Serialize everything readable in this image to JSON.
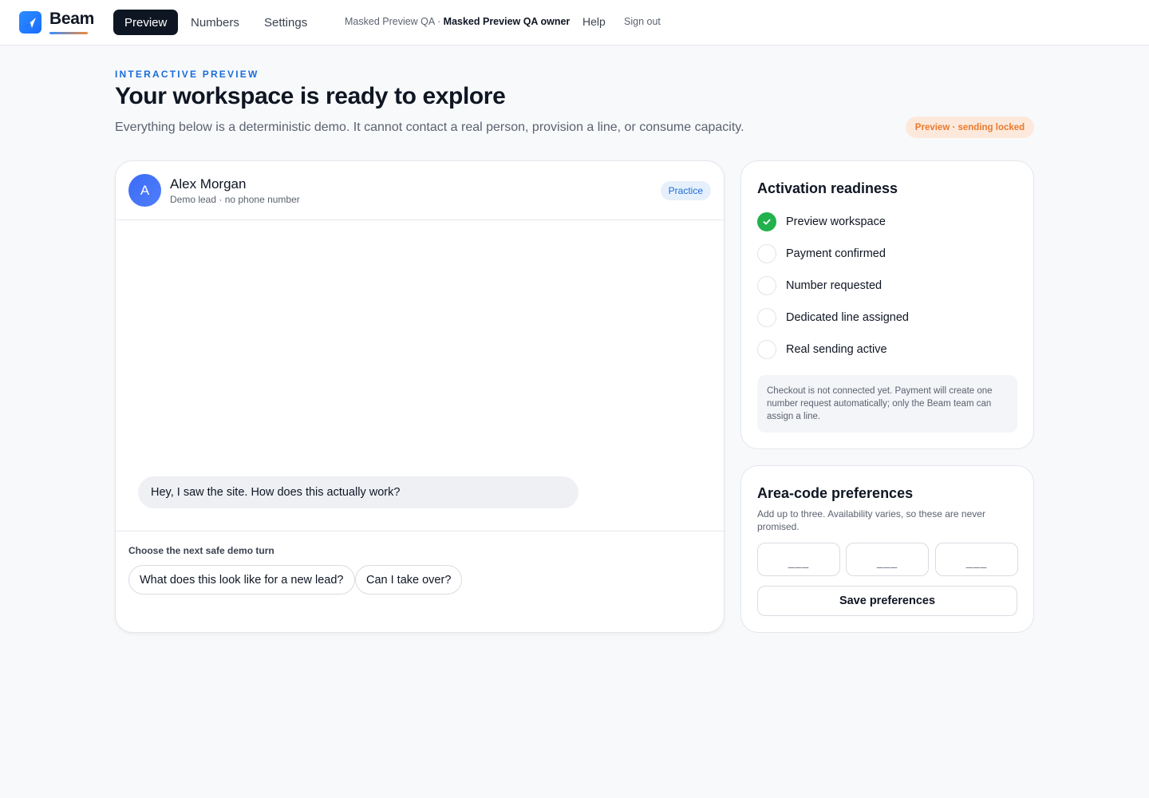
{
  "brand": {
    "name": "Beam"
  },
  "nav": {
    "tabs": [
      {
        "label": "Preview",
        "active": true
      },
      {
        "label": "Numbers",
        "active": false
      },
      {
        "label": "Settings",
        "active": false
      }
    ],
    "workspace_name": "Masked Preview QA",
    "workspace_separator": " · ",
    "workspace_role": "Masked Preview QA owner",
    "help_label": "Help",
    "signout_label": "Sign out"
  },
  "header": {
    "eyebrow": "INTERACTIVE PREVIEW",
    "title": "Your workspace is ready to explore",
    "subtitle": "Everything below is a deterministic demo. It cannot contact a real person, provision a line, or consume capacity.",
    "status_badge": "Preview · sending locked"
  },
  "conversation": {
    "avatar_initial": "A",
    "contact_name": "Alex Morgan",
    "contact_sub": "Demo lead · no phone number",
    "mode_badge": "Practice",
    "messages": [
      {
        "from": "lead",
        "text": "Hey, I saw the site. How does this actually work?"
      }
    ],
    "next_turn_label": "Choose the next safe demo turn",
    "choices": [
      "What does this look like for a new lead?",
      "Can I take over?"
    ]
  },
  "readiness": {
    "title": "Activation readiness",
    "items": [
      {
        "label": "Preview workspace",
        "done": true
      },
      {
        "label": "Payment confirmed",
        "done": false
      },
      {
        "label": "Number requested",
        "done": false
      },
      {
        "label": "Dedicated line assigned",
        "done": false
      },
      {
        "label": "Real sending active",
        "done": false
      }
    ],
    "note": "Checkout is not connected yet. Payment will create one number request automatically; only the Beam team can assign a line."
  },
  "area_codes": {
    "title": "Area-code preferences",
    "description": "Add up to three. Availability varies, so these are never promised.",
    "inputs": [
      {
        "value": "",
        "placeholder": "___"
      },
      {
        "value": "",
        "placeholder": "___"
      },
      {
        "value": "",
        "placeholder": "___"
      }
    ],
    "save_label": "Save preferences"
  },
  "colors": {
    "accent": "#1a6dd9",
    "nav_active_bg": "#0f1623",
    "success": "#22b14c",
    "warning_text": "#e97a2e",
    "warning_bg": "#fde9dc"
  },
  "icons": {
    "logo": "paper-plane-icon",
    "check": "check-icon"
  }
}
